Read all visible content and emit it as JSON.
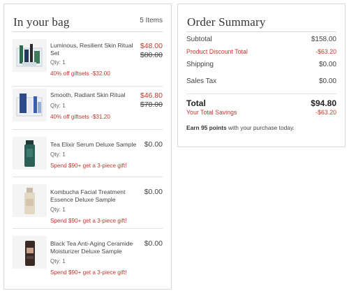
{
  "bag": {
    "title": "In your bag",
    "count": "5 Items",
    "items": [
      {
        "name": "Luminous, Resilient Skin Ritual Set",
        "qty": "Qty: 1",
        "price": "$48.00",
        "original_price": "$80.00",
        "promo": "40% off giftsets -$32.00",
        "image_icon": "gift-set-image"
      },
      {
        "name": "Smooth, Radiant Skin Ritual",
        "qty": "Qty: 1",
        "price": "$46.80",
        "original_price": "$78.00",
        "promo": "40% off giftsets -$31.20",
        "image_icon": "gift-set-image"
      },
      {
        "name": "Tea Elixir Serum Deluxe Sample",
        "qty": "Qty: 1",
        "price": "$0.00",
        "promo": "Spend $90+ get a 3-piece gift!",
        "image_icon": "serum-bottle-image"
      },
      {
        "name": "Kombucha Facial Treatment Essence Deluxe Sample",
        "qty": "Qty: 1",
        "price": "$0.00",
        "promo": "Spend $90+ get a 3-piece gift!",
        "image_icon": "essence-bottle-image"
      },
      {
        "name": "Black Tea Anti-Aging Ceramide Moisturizer Deluxe Sample",
        "qty": "Qty: 1",
        "price": "$0.00",
        "promo": "Spend $90+ get a 3-piece gift!",
        "image_icon": "moisturizer-jar-image"
      }
    ]
  },
  "summary": {
    "title": "Order Summary",
    "subtotal_label": "Subtotal",
    "subtotal": "$158.00",
    "discount_label": "Product Discount Total",
    "discount": "-$63.20",
    "shipping_label": "Shipping",
    "shipping": "$0.00",
    "tax_label": "Sales Tax",
    "tax": "$0.00",
    "total_label": "Total",
    "total": "$94.80",
    "savings_label": "Your Total Savings",
    "savings": "-$63.20",
    "points_bold": "Earn 95 points",
    "points_rest": " with your purchase today."
  },
  "colors": {
    "sale_red": "#c0392b",
    "text": "#444444",
    "border": "#d6d6d6"
  }
}
